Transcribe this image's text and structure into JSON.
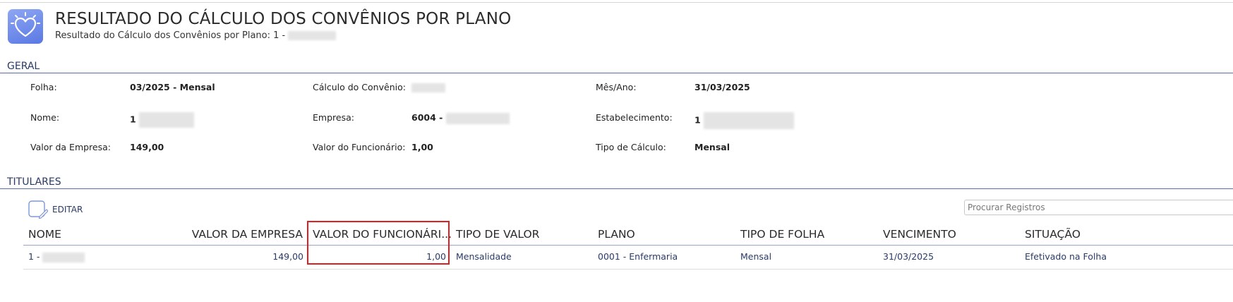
{
  "header": {
    "title": "RESULTADO DO CÁLCULO DOS CONVÊNIOS POR PLANO",
    "subtitle": "Resultado do Cálculo dos Convênios por Plano: 1 -",
    "icon": "heart-icon"
  },
  "geral": {
    "section_title": "GERAL",
    "folha_label": "Folha:",
    "folha_value": "03/2025",
    "folha_suffix": " - Mensal",
    "calculo_label": "Cálculo do Convênio:",
    "mes_ano_label": "Mês/Ano:",
    "mes_ano_value": "31/03/2025",
    "nome_label": "Nome:",
    "nome_value": "1",
    "empresa_label": "Empresa:",
    "empresa_value": "6004 -",
    "estabelecimento_label": "Estabelecimento:",
    "estabelecimento_value": "1",
    "valor_empresa_label": "Valor da Empresa:",
    "valor_empresa_value": "149,00",
    "valor_funcionario_label": "Valor do Funcionário:",
    "valor_funcionario_value": "1,00",
    "tipo_calculo_label": "Tipo de Cálculo:",
    "tipo_calculo_value": "Mensal"
  },
  "titulares": {
    "section_title": "TITULARES",
    "edit_label": "EDITAR",
    "search_placeholder": "Procurar Registros",
    "columns": [
      "NOME",
      "VALOR DA EMPRESA",
      "VALOR DO FUNCIONÁRI...",
      "TIPO DE VALOR",
      "PLANO",
      "TIPO DE FOLHA",
      "VENCIMENTO",
      "SITUAÇÃO"
    ],
    "rows": [
      [
        "1 -",
        "149,00",
        "1,00",
        "Mensalidade",
        "0001 - Enfermaria",
        "Mensal",
        "31/03/2025",
        "Efetivado na Folha"
      ]
    ]
  },
  "colors": {
    "accent": "#5b6bb0",
    "link_text": "#2a3a66",
    "highlight_border": "#e02020",
    "icon_bg": "#6f8ce8"
  }
}
